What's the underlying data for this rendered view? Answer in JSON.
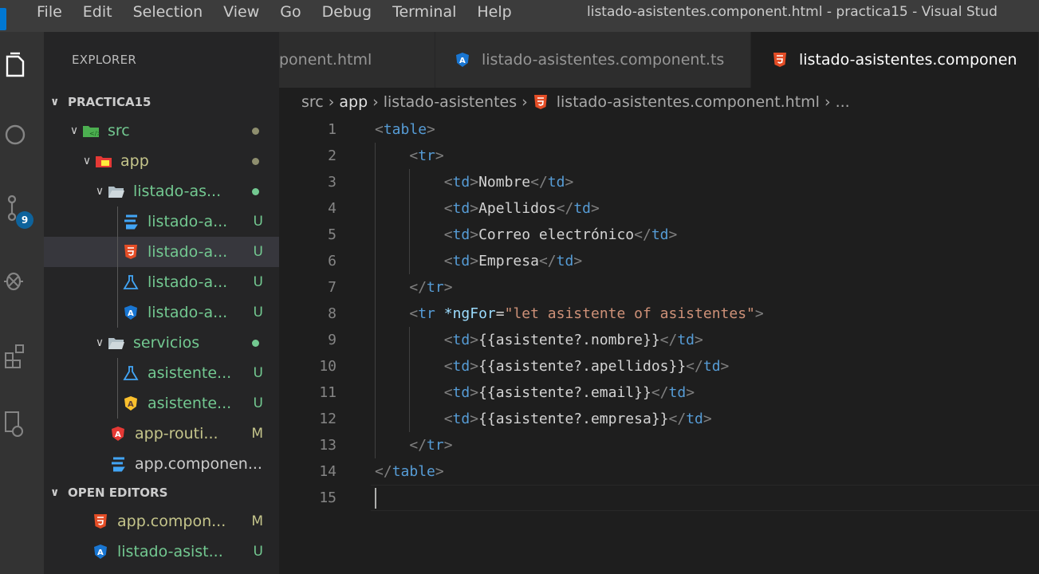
{
  "menu": [
    "File",
    "Edit",
    "Selection",
    "View",
    "Go",
    "Debug",
    "Terminal",
    "Help"
  ],
  "window_title": "listado-asistentes.component.html - practica15 - Visual Stud",
  "activity": {
    "scm_badge": "9"
  },
  "explorer": {
    "title": "EXPLORER",
    "project": "PRACTICA15",
    "items": [
      {
        "label": "src",
        "status": "",
        "depth": 1
      },
      {
        "label": "app",
        "status": "",
        "depth": 2
      },
      {
        "label": "listado-as...",
        "status": "",
        "depth": 3
      },
      {
        "label": "listado-a...",
        "status": "U",
        "depth": 4,
        "icon": "css-icon"
      },
      {
        "label": "listado-a...",
        "status": "U",
        "depth": 4,
        "icon": "html-icon"
      },
      {
        "label": "listado-a...",
        "status": "U",
        "depth": 4,
        "icon": "test-flask-icon"
      },
      {
        "label": "listado-a...",
        "status": "U",
        "depth": 4,
        "icon": "angular-icon"
      },
      {
        "label": "servicios",
        "status": "",
        "depth": 3
      },
      {
        "label": "asistente...",
        "status": "U",
        "depth": 4,
        "icon": "test-flask-icon"
      },
      {
        "label": "asistente...",
        "status": "U",
        "depth": 4,
        "icon": "angular-service-icon"
      },
      {
        "label": "app-routi...",
        "status": "M",
        "depth": 3,
        "icon": "angular-routing-icon"
      },
      {
        "label": "app.componen...",
        "status": "",
        "depth": 3,
        "icon": "css-icon"
      }
    ],
    "open_editors_title": "OPEN EDITORS",
    "open_editors": [
      {
        "label": "app.compon...",
        "status": "M"
      },
      {
        "label": "listado-asist...",
        "status": "U"
      }
    ]
  },
  "tabs": [
    {
      "label": "ponent.html"
    },
    {
      "label": "listado-asistentes.component.ts"
    },
    {
      "label": "listado-asistentes.componen"
    }
  ],
  "breadcrumb": [
    "src",
    "app",
    "listado-asistentes",
    "listado-asistentes.component.html",
    "..."
  ],
  "editor": {
    "line_numbers": [
      "1",
      "2",
      "3",
      "4",
      "5",
      "6",
      "7",
      "8",
      "9",
      "10",
      "11",
      "12",
      "13",
      "14",
      "15"
    ],
    "lines": [
      {
        "indent": "",
        "parts": [
          [
            "br",
            "<"
          ],
          [
            "tag",
            "table"
          ],
          [
            "br",
            ">"
          ]
        ]
      },
      {
        "indent": "    ",
        "parts": [
          [
            "br",
            "<"
          ],
          [
            "tag",
            "tr"
          ],
          [
            "br",
            ">"
          ]
        ]
      },
      {
        "indent": "        ",
        "parts": [
          [
            "br",
            "<"
          ],
          [
            "tag",
            "td"
          ],
          [
            "br",
            ">"
          ],
          [
            "txt",
            "Nombre"
          ],
          [
            "br",
            "</"
          ],
          [
            "tag",
            "td"
          ],
          [
            "br",
            ">"
          ]
        ]
      },
      {
        "indent": "        ",
        "parts": [
          [
            "br",
            "<"
          ],
          [
            "tag",
            "td"
          ],
          [
            "br",
            ">"
          ],
          [
            "txt",
            "Apellidos"
          ],
          [
            "br",
            "</"
          ],
          [
            "tag",
            "td"
          ],
          [
            "br",
            ">"
          ]
        ]
      },
      {
        "indent": "        ",
        "parts": [
          [
            "br",
            "<"
          ],
          [
            "tag",
            "td"
          ],
          [
            "br",
            ">"
          ],
          [
            "txt",
            "Correo electrónico"
          ],
          [
            "br",
            "</"
          ],
          [
            "tag",
            "td"
          ],
          [
            "br",
            ">"
          ]
        ]
      },
      {
        "indent": "        ",
        "parts": [
          [
            "br",
            "<"
          ],
          [
            "tag",
            "td"
          ],
          [
            "br",
            ">"
          ],
          [
            "txt",
            "Empresa"
          ],
          [
            "br",
            "</"
          ],
          [
            "tag",
            "td"
          ],
          [
            "br",
            ">"
          ]
        ]
      },
      {
        "indent": "    ",
        "parts": [
          [
            "br",
            "</"
          ],
          [
            "tag",
            "tr"
          ],
          [
            "br",
            ">"
          ]
        ]
      },
      {
        "indent": "    ",
        "parts": [
          [
            "br",
            "<"
          ],
          [
            "tag",
            "tr"
          ],
          [
            "txt",
            " "
          ],
          [
            "attr",
            "*ngFor"
          ],
          [
            "txt",
            "="
          ],
          [
            "str",
            "\"let asistente of asistentes\""
          ],
          [
            "br",
            ">"
          ]
        ]
      },
      {
        "indent": "        ",
        "parts": [
          [
            "br",
            "<"
          ],
          [
            "tag",
            "td"
          ],
          [
            "br",
            ">"
          ],
          [
            "txt",
            "{{asistente?.nombre}}"
          ],
          [
            "br",
            "</"
          ],
          [
            "tag",
            "td"
          ],
          [
            "br",
            ">"
          ]
        ]
      },
      {
        "indent": "        ",
        "parts": [
          [
            "br",
            "<"
          ],
          [
            "tag",
            "td"
          ],
          [
            "br",
            ">"
          ],
          [
            "txt",
            "{{asistente?.apellidos}}"
          ],
          [
            "br",
            "</"
          ],
          [
            "tag",
            "td"
          ],
          [
            "br",
            ">"
          ]
        ]
      },
      {
        "indent": "        ",
        "parts": [
          [
            "br",
            "<"
          ],
          [
            "tag",
            "td"
          ],
          [
            "br",
            ">"
          ],
          [
            "txt",
            "{{asistente?.email}}"
          ],
          [
            "br",
            "</"
          ],
          [
            "tag",
            "td"
          ],
          [
            "br",
            ">"
          ]
        ]
      },
      {
        "indent": "        ",
        "parts": [
          [
            "br",
            "<"
          ],
          [
            "tag",
            "td"
          ],
          [
            "br",
            ">"
          ],
          [
            "txt",
            "{{asistente?.empresa}}"
          ],
          [
            "br",
            "</"
          ],
          [
            "tag",
            "td"
          ],
          [
            "br",
            ">"
          ]
        ]
      },
      {
        "indent": "    ",
        "parts": [
          [
            "br",
            "</"
          ],
          [
            "tag",
            "tr"
          ],
          [
            "br",
            ">"
          ]
        ]
      },
      {
        "indent": "",
        "parts": [
          [
            "br",
            "</"
          ],
          [
            "tag",
            "table"
          ],
          [
            "br",
            ">"
          ]
        ]
      },
      {
        "indent": "",
        "parts": []
      }
    ]
  },
  "colors": {
    "untracked": "#73c991",
    "modified": "#c5c58b",
    "html": "#e44d26",
    "angular": "#dd0031",
    "css": "#2965f1",
    "tag": "#569cd6"
  }
}
